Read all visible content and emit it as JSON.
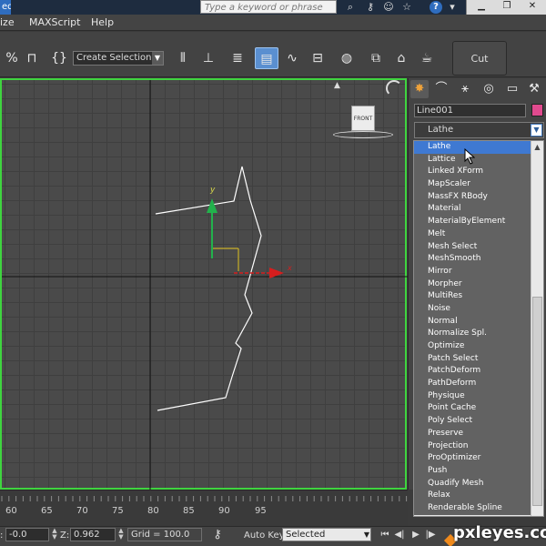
{
  "titlebar": {
    "left_fragment": "ed",
    "search_placeholder": "Type a keyword or phrase",
    "help_glyph": "?"
  },
  "menubar": {
    "items": [
      "ize",
      "MAXScript",
      "Help"
    ]
  },
  "toolbar": {
    "selection_set_label": "Create Selection Se",
    "cut_label": "Cut"
  },
  "viewport": {
    "cube_label": "FRONT",
    "gizmo": {
      "x_axis_label": "x",
      "y_axis_label": "y"
    }
  },
  "command_panel": {
    "object_name": "Line001",
    "object_color": "#e04a8e",
    "modifier_list_value": "Lathe"
  },
  "modifier_list": {
    "highlighted": "Lathe",
    "items": [
      "Lathe",
      "Lattice",
      "Linked XForm",
      "MapScaler",
      "MassFX RBody",
      "Material",
      "MaterialByElement",
      "Melt",
      "Mesh Select",
      "MeshSmooth",
      "Mirror",
      "Morpher",
      "MultiRes",
      "Noise",
      "Normal",
      "Normalize Spl.",
      "Optimize",
      "Patch Select",
      "PatchDeform",
      "PathDeform",
      "Physique",
      "Point Cache",
      "Poly Select",
      "Preserve",
      "Projection",
      "ProOptimizer",
      "Push",
      "Quadify Mesh",
      "Relax",
      "Renderable Spline"
    ]
  },
  "timeline": {
    "labels": [
      "60",
      "65",
      "70",
      "75",
      "80",
      "85",
      "90",
      "95"
    ]
  },
  "status": {
    "x_value": "-0.0",
    "z_label": "Z:",
    "z_value": "0.962",
    "grid": "Grid = 100.0",
    "autokey": "Auto Key",
    "key_filter": "Selected"
  },
  "watermark": "pxleyes.com",
  "colors": {
    "viewport_border": "#3fd43f",
    "highlight": "#3f79d2",
    "axis_y": "#22b14c",
    "axis_x": "#d61e1e"
  }
}
